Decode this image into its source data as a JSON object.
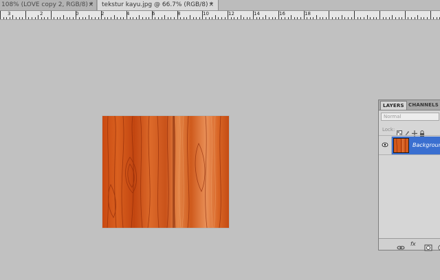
{
  "tabs": [
    {
      "label": "108% (LOVE copy 2, RGB/8) *",
      "active": false
    },
    {
      "label": "tekstur kayu.jpg @ 66.7% (RGB/8) *",
      "active": true
    }
  ],
  "tab_close_glyph": "×",
  "ruler": {
    "labels": [
      "3",
      "2",
      "0",
      "2",
      "4",
      "6",
      "8",
      "10",
      "12",
      "14",
      "16",
      "18"
    ]
  },
  "layers_panel": {
    "tabs": [
      "LAYERS",
      "CHANNELS"
    ],
    "blend_mode": "Normal",
    "lock_label": "Lock:",
    "layers": [
      {
        "name": "Background",
        "visible": true,
        "selected": true
      }
    ],
    "footer_icons": [
      "link-icon",
      "fx-icon",
      "mask-icon",
      "adjustment-icon"
    ],
    "footer_fx_label": "fx"
  },
  "colors": {
    "canvas_bg": "#c1c1c1",
    "selection": "#3a6fd0",
    "wood_base": "#d4561a",
    "wood_light": "#e88a4a",
    "wood_dark": "#9b300c"
  }
}
